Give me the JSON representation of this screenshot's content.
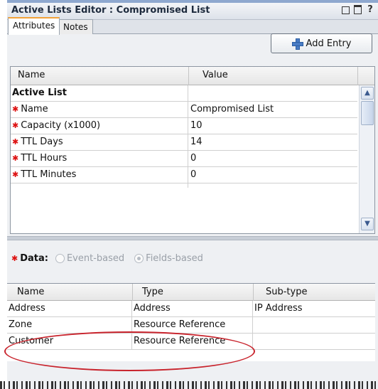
{
  "window": {
    "title": "Active Lists Editor : Compromised List",
    "controls": [
      "minimize-icon",
      "restore-icon",
      "help-icon"
    ],
    "help_glyph": "?"
  },
  "tabs": [
    {
      "label": "Attributes",
      "active": true
    },
    {
      "label": "Notes",
      "active": false
    }
  ],
  "toolbar": {
    "add_entry_label": "Add Entry"
  },
  "attributes_grid": {
    "columns": [
      "Name",
      "Value"
    ],
    "rows": [
      {
        "name": "Active List",
        "value": "",
        "required": false,
        "section": true
      },
      {
        "name": "Name",
        "value": "Compromised List",
        "required": true
      },
      {
        "name": "Capacity (x1000)",
        "value": "10",
        "required": true
      },
      {
        "name": "TTL Days",
        "value": "14",
        "required": true
      },
      {
        "name": "TTL Hours",
        "value": "0",
        "required": true
      },
      {
        "name": "TTL Minutes",
        "value": "0",
        "required": true
      }
    ]
  },
  "data_section": {
    "label": "Data:",
    "required": true,
    "options": [
      {
        "label": "Event-based",
        "selected": false
      },
      {
        "label": "Fields-based",
        "selected": true
      }
    ]
  },
  "fields_grid": {
    "columns": [
      "Name",
      "Type",
      "Sub-type"
    ],
    "rows": [
      {
        "name": "Address",
        "type": "Address",
        "subtype": "IP Address"
      },
      {
        "name": "Zone",
        "type": "Resource Reference",
        "subtype": ""
      },
      {
        "name": "Customer",
        "type": "Resource Reference",
        "subtype": ""
      }
    ]
  },
  "colors": {
    "required_star": "#dd1111",
    "highlight_ring": "#c8232c",
    "active_tab_accent": "#f2a23a"
  }
}
